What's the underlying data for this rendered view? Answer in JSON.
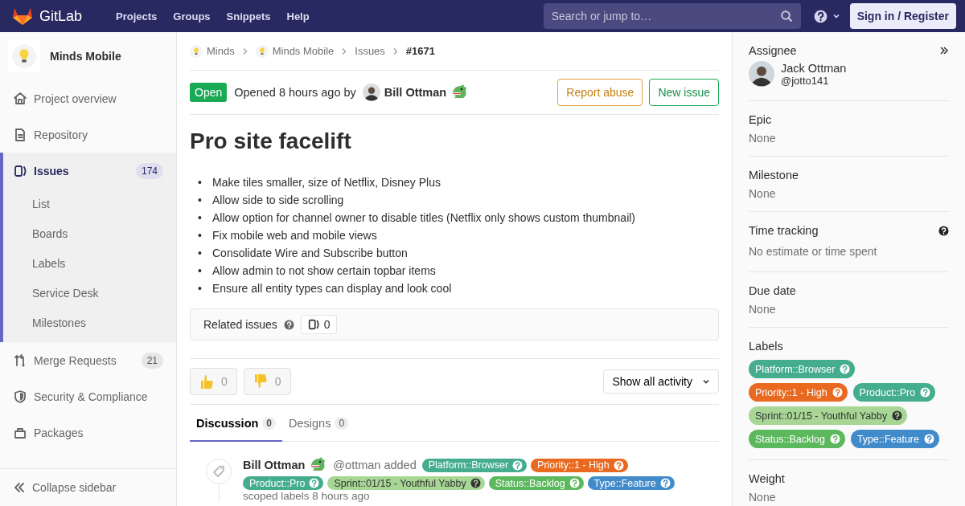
{
  "navbar": {
    "brand": "GitLab",
    "links": [
      "Projects",
      "Groups",
      "Snippets",
      "Help"
    ],
    "search": {
      "placeholder": "Search or jump to…"
    },
    "sign_in": "Sign in / Register"
  },
  "sidebar": {
    "project": "Minds Mobile",
    "items": [
      {
        "label": "Project overview",
        "kind": "overview",
        "selected": false
      },
      {
        "label": "Repository",
        "kind": "repository",
        "selected": false
      },
      {
        "label": "Issues",
        "kind": "issues",
        "count": "174",
        "selected": true,
        "children": [
          {
            "label": "List"
          },
          {
            "label": "Boards"
          },
          {
            "label": "Labels"
          },
          {
            "label": "Service Desk"
          },
          {
            "label": "Milestones"
          }
        ]
      },
      {
        "label": "Merge Requests",
        "kind": "merge_requests",
        "count": "21",
        "selected": false
      },
      {
        "label": "Security & Compliance",
        "kind": "security",
        "selected": false
      },
      {
        "label": "Packages",
        "kind": "packages",
        "selected": false
      }
    ],
    "collapse": "Collapse sidebar"
  },
  "breadcrumbs": [
    {
      "label": "Minds",
      "avatar": true
    },
    {
      "label": "Minds Mobile",
      "avatar": true
    },
    {
      "label": "Issues",
      "avatar": false
    },
    {
      "label": "#1671",
      "avatar": false
    }
  ],
  "issue": {
    "status": "Open",
    "opened": "Opened 8 hours ago by",
    "author": "Bill Ottman",
    "buttons": [
      {
        "label": "Report abuse",
        "kind": "warning"
      },
      {
        "label": "New issue",
        "kind": "success"
      }
    ],
    "title": "Pro site facelift",
    "description": [
      {
        "marker": "•",
        "text": "Make tiles smaller, size of Netflix, Disney Plus"
      },
      {
        "marker": "•",
        "text": "Allow side to side scrolling"
      },
      {
        "marker": "•",
        "text": "Allow option for channel owner to disable titles (Netflix only shows custom thumbnail)"
      },
      {
        "marker": "•",
        "text": "Fix mobile web and mobile views"
      },
      {
        "marker": "•",
        "text": "Consolidate Wire and Subscribe button"
      },
      {
        "marker": "•",
        "text": "Allow admin to not show certain topbar items"
      },
      {
        "marker": "•",
        "text": "Ensure all entity types can display and look cool"
      }
    ]
  },
  "related": {
    "label": "Related issues",
    "count": "0"
  },
  "reactions": [
    {
      "kind": "thumbsup",
      "count": "0"
    },
    {
      "kind": "thumbsdown",
      "count": "0"
    }
  ],
  "activity_filter": "Show all activity",
  "tabs": [
    {
      "label": "Discussion",
      "count": "0",
      "selected": true
    },
    {
      "label": "Designs",
      "count": "0",
      "selected": false
    }
  ],
  "note": {
    "author": "Bill Ottman",
    "action": "@ottman added",
    "labels": [
      {
        "text": "Platform::Browser",
        "color": "#44ad8e"
      },
      {
        "text": "Priority::1 - High",
        "color": "#e8691f"
      },
      {
        "text": "Product::Pro",
        "color": "#44ad8e"
      },
      {
        "text": "Sprint::01/15 - Youthful Yabby",
        "color": "#a8d695"
      },
      {
        "text": "Status::Backlog",
        "color": "#5cb85c"
      },
      {
        "text": "Type::Feature",
        "color": "#428bca"
      }
    ],
    "footer": "scoped labels 8 hours ago"
  },
  "right_sidebar": {
    "sections": [
      {
        "kind": "assignee",
        "heading": "Assignee",
        "name": "Jack Ottman",
        "username": "@jotto141"
      },
      {
        "kind": "text",
        "heading": "Epic",
        "value": "None"
      },
      {
        "kind": "text",
        "heading": "Milestone",
        "value": "None"
      },
      {
        "kind": "text",
        "heading": "Time tracking",
        "value": "No estimate or time spent",
        "help": true
      },
      {
        "kind": "text",
        "heading": "Due date",
        "value": "None"
      },
      {
        "kind": "labels",
        "heading": "Labels",
        "labels": [
          {
            "text": "Platform::Browser",
            "color": "#44ad8e"
          },
          {
            "text": "Priority::1 - High",
            "color": "#e8691f"
          },
          {
            "text": "Product::Pro",
            "color": "#44ad8e"
          },
          {
            "text": "Sprint::01/15 - Youthful Yabby",
            "color": "#a8d695"
          },
          {
            "text": "Status::Backlog",
            "color": "#5cb85c"
          },
          {
            "text": "Type::Feature",
            "color": "#428bca"
          }
        ]
      },
      {
        "kind": "text",
        "heading": "Weight",
        "value": "None"
      }
    ]
  }
}
